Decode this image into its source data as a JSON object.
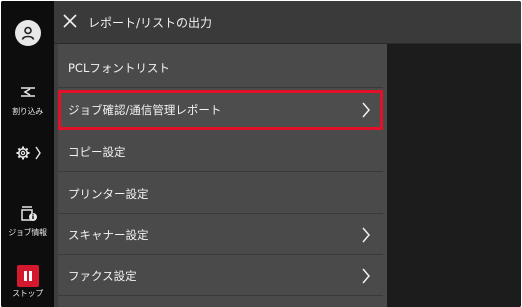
{
  "header": {
    "title": "レポート/リストの出力"
  },
  "sidebar": {
    "interrupt_label": "割り込み",
    "job_info_label": "ジョブ情報",
    "stop_label": "ストップ"
  },
  "menu": {
    "items": [
      {
        "label": "PCLフォントリスト",
        "has_submenu": false
      },
      {
        "label": "ジョブ確認/通信管理レポート",
        "has_submenu": true,
        "highlighted": true
      },
      {
        "label": "コピー設定",
        "has_submenu": false
      },
      {
        "label": "プリンター設定",
        "has_submenu": false
      },
      {
        "label": "スキャナー設定",
        "has_submenu": true
      },
      {
        "label": "ファクス設定",
        "has_submenu": true
      }
    ]
  },
  "colors": {
    "highlight_border": "#e3102a",
    "stop_button": "#d6182f"
  }
}
